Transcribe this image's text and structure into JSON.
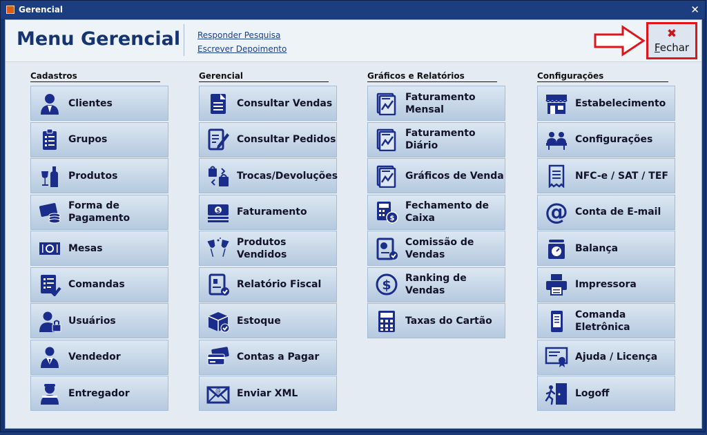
{
  "window": {
    "title": "Gerencial",
    "close_glyph": "✕"
  },
  "header": {
    "title": "Menu Gerencial",
    "links": [
      "Responder Pesquisa",
      "Escrever Depoimento"
    ],
    "close_button": {
      "icon": "x-icon",
      "label": "Fechar"
    }
  },
  "columns": [
    {
      "title": "Cadastros",
      "items": [
        {
          "label": "Clientes",
          "icon": "person"
        },
        {
          "label": "Grupos",
          "icon": "clipboard"
        },
        {
          "label": "Produtos",
          "icon": "wine"
        },
        {
          "label": "Forma de\nPagamento",
          "icon": "card-coins"
        },
        {
          "label": "Mesas",
          "icon": "plate"
        },
        {
          "label": "Comandas",
          "icon": "list-check"
        },
        {
          "label": "Usuários",
          "icon": "user-lock"
        },
        {
          "label": "Vendedor",
          "icon": "suit"
        },
        {
          "label": "Entregador",
          "icon": "delivery"
        }
      ]
    },
    {
      "title": "Gerencial",
      "items": [
        {
          "label": "Consultar Vendas",
          "icon": "document"
        },
        {
          "label": "Consultar Pedidos",
          "icon": "edit-doc"
        },
        {
          "label": "Trocas/Devoluções",
          "icon": "bags"
        },
        {
          "label": "Faturamento",
          "icon": "money"
        },
        {
          "label": "Produtos Vendidos",
          "icon": "glasses"
        },
        {
          "label": "Relatório Fiscal",
          "icon": "report-check"
        },
        {
          "label": "Estoque",
          "icon": "box"
        },
        {
          "label": "Contas a Pagar",
          "icon": "cards"
        },
        {
          "label": "Enviar XML",
          "icon": "envelope"
        }
      ]
    },
    {
      "title": "Gráficos e Relatórios",
      "items": [
        {
          "label": "Faturamento\nMensal",
          "icon": "chart-doc"
        },
        {
          "label": "Faturamento\nDiário",
          "icon": "chart-doc"
        },
        {
          "label": "Gráficos de Venda",
          "icon": "chart-doc"
        },
        {
          "label": "Fechamento de\nCaixa",
          "icon": "calculator-coin"
        },
        {
          "label": "Comissão de\nVendas",
          "icon": "pie-doc"
        },
        {
          "label": "Ranking de\nVendas",
          "icon": "dollar-circle"
        },
        {
          "label": "Taxas do Cartão",
          "icon": "calculator"
        }
      ]
    },
    {
      "title": "Configurações",
      "items": [
        {
          "label": "Estabelecimento",
          "icon": "store"
        },
        {
          "label": "Configurações",
          "icon": "people-table"
        },
        {
          "label": "NFC-e / SAT / TEF",
          "icon": "receipt"
        },
        {
          "label": "Conta de E-mail",
          "icon": "at"
        },
        {
          "label": "Balança",
          "icon": "scale"
        },
        {
          "label": "Impressora",
          "icon": "printer"
        },
        {
          "label": "Comanda\nEletrônica",
          "icon": "phone"
        },
        {
          "label": "Ajuda / Licença",
          "icon": "certificate"
        },
        {
          "label": "Logoff",
          "icon": "exit"
        }
      ]
    }
  ]
}
